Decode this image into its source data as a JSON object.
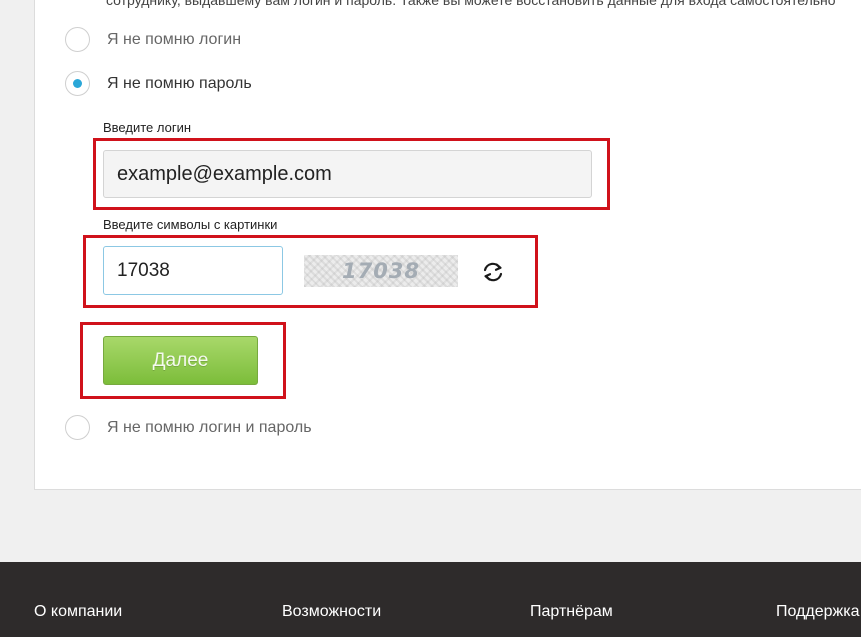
{
  "intro_text": "сотруднику, выдавшему вам логин и пароль. Также вы можете восстановить данные для входа самостоятельно",
  "options": [
    {
      "label": "Я не помню логин",
      "selected": false
    },
    {
      "label": "Я не помню пароль",
      "selected": true
    },
    {
      "label": "Я не помню логин и пароль",
      "selected": false
    }
  ],
  "form": {
    "login_label": "Введите логин",
    "login_value": "example@example.com",
    "captcha_label": "Введите символы с картинки",
    "captcha_value": "17038",
    "captcha_image_text": "17038",
    "refresh_icon": "refresh-icon",
    "submit_label": "Далее"
  },
  "highlight_color": "#d0121b",
  "footer": {
    "links": [
      "О компании",
      "Возможности",
      "Партнёрам",
      "Поддержка"
    ]
  }
}
